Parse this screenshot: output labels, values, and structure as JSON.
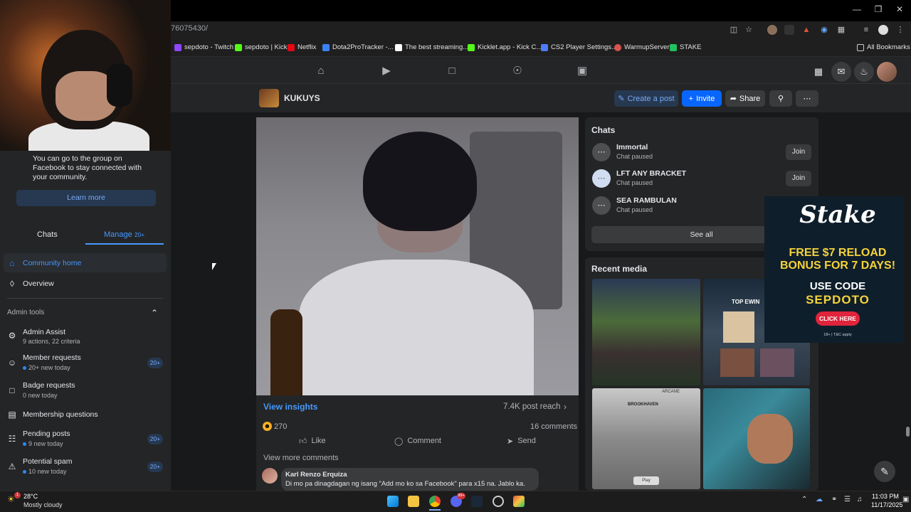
{
  "browser": {
    "url": "76075430/",
    "bookmarks": [
      {
        "label": "sepdoto - Twitch",
        "color": "#9146ff"
      },
      {
        "label": "sepdoto | Kick",
        "color": "#53fc18"
      },
      {
        "label": "Netflix",
        "color": "#e50914"
      },
      {
        "label": "Dota2ProTracker -...",
        "color": "#3b82f6"
      },
      {
        "label": "The best streaming...",
        "color": "#ffffff"
      },
      {
        "label": "Kicklet.app - Kick C...",
        "color": "#53fc18"
      },
      {
        "label": "CS2 Player Settings...",
        "color": "#4f7bff"
      },
      {
        "label": "WarmupServer",
        "color": "#d9534f"
      },
      {
        "label": "STAKE",
        "color": "#21c25e"
      }
    ],
    "all_bookmarks": "All Bookmarks"
  },
  "group": {
    "name": "KUKUYS",
    "create_post": "Create a post",
    "invite": "Invite",
    "share": "Share"
  },
  "sidebar": {
    "promo_text": "You can go to the group on Facebook to stay connected with your community.",
    "learn_more": "Learn more",
    "tabs": {
      "chats": "Chats",
      "manage": "Manage",
      "manage_badge": "20+"
    },
    "community_home": "Community home",
    "overview": "Overview",
    "admin_tools": "Admin tools",
    "items": [
      {
        "title": "Admin Assist",
        "sub": "9 actions, 22 criteria",
        "badge": "",
        "dot": false
      },
      {
        "title": "Member requests",
        "sub": "20+ new today",
        "badge": "20+",
        "dot": true
      },
      {
        "title": "Badge requests",
        "sub": "0 new today",
        "badge": "",
        "dot": false
      },
      {
        "title": "Membership questions",
        "sub": "",
        "badge": "",
        "dot": false
      },
      {
        "title": "Pending posts",
        "sub": "9 new today",
        "badge": "20+",
        "dot": true
      },
      {
        "title": "Potential spam",
        "sub": "10 new today",
        "badge": "20+",
        "dot": true
      }
    ]
  },
  "post": {
    "view_insights": "View insights",
    "reach": "7.4K post reach",
    "reactions": "270",
    "comments_count": "16 comments",
    "like": "Like",
    "comment": "Comment",
    "send": "Send",
    "view_more_comments": "View more comments",
    "comment_author": "Karl Renzo Erquiza",
    "comment_text": "Di mo pa dinagdagan ng isang \"Add mo ko sa Facebook\" para x15 na. Jablo ka."
  },
  "chats": {
    "title": "Chats",
    "items": [
      {
        "name": "Immortal",
        "status": "Chat paused",
        "action": "Join"
      },
      {
        "name": "LFT ANY BRACKET",
        "status": "Chat paused",
        "action": "Join"
      },
      {
        "name": "SEA RAMBULAN",
        "status": "Chat paused",
        "action": ""
      }
    ],
    "see_all": "See all"
  },
  "media": {
    "title": "Recent media",
    "thumb_texts": [
      "TOP EWIN",
      "ARCANE",
      "BROOKHAVEN",
      "Play"
    ]
  },
  "ad": {
    "logo": "Stake",
    "line1": "FREE $7 RELOAD",
    "line2": "BONUS FOR 7 DAYS!",
    "line3": "USE CODE",
    "line4": "SEPDOTO",
    "cta": "CLICK HERE",
    "fine": "18+ | T&C apply"
  },
  "taskbar": {
    "temp": "28°C",
    "weather": "Mostly cloudy",
    "weather_badge": "1",
    "discord_badge": "99+",
    "time": "11:03 PM",
    "date": "11/17/2025"
  },
  "colors": {
    "accent": "#0866ff",
    "fb_link": "#4599ff",
    "bg": "#18191a",
    "card": "#242526"
  }
}
